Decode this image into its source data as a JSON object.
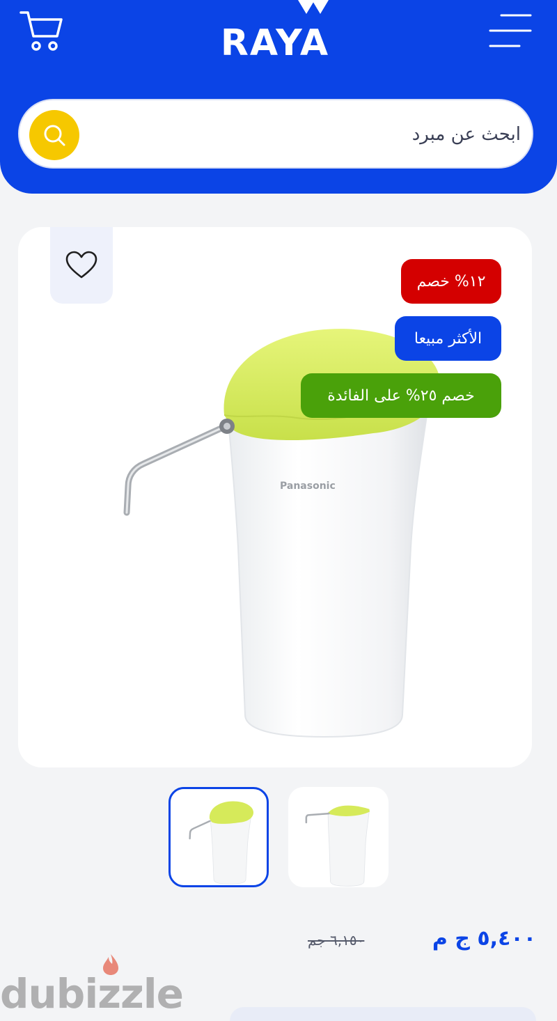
{
  "header": {
    "logo_text": "RAYA",
    "search": {
      "placeholder": "ابحث عن مبرد"
    }
  },
  "product": {
    "badges": {
      "discount": "١٢% خصم",
      "best_seller": "الأكثر مبيعا",
      "interest": "خصم ٢٥% على الفائدة"
    },
    "image_brand": "Panasonic",
    "price_current": "٥,٤٠٠ ج م",
    "price_old": "٦,١٥٠ جم"
  },
  "watermark": "dubizzle",
  "colors": {
    "brand_blue": "#0b44e6",
    "search_yellow": "#f6c800",
    "discount_red": "#d40000",
    "interest_green": "#4aa10a"
  }
}
